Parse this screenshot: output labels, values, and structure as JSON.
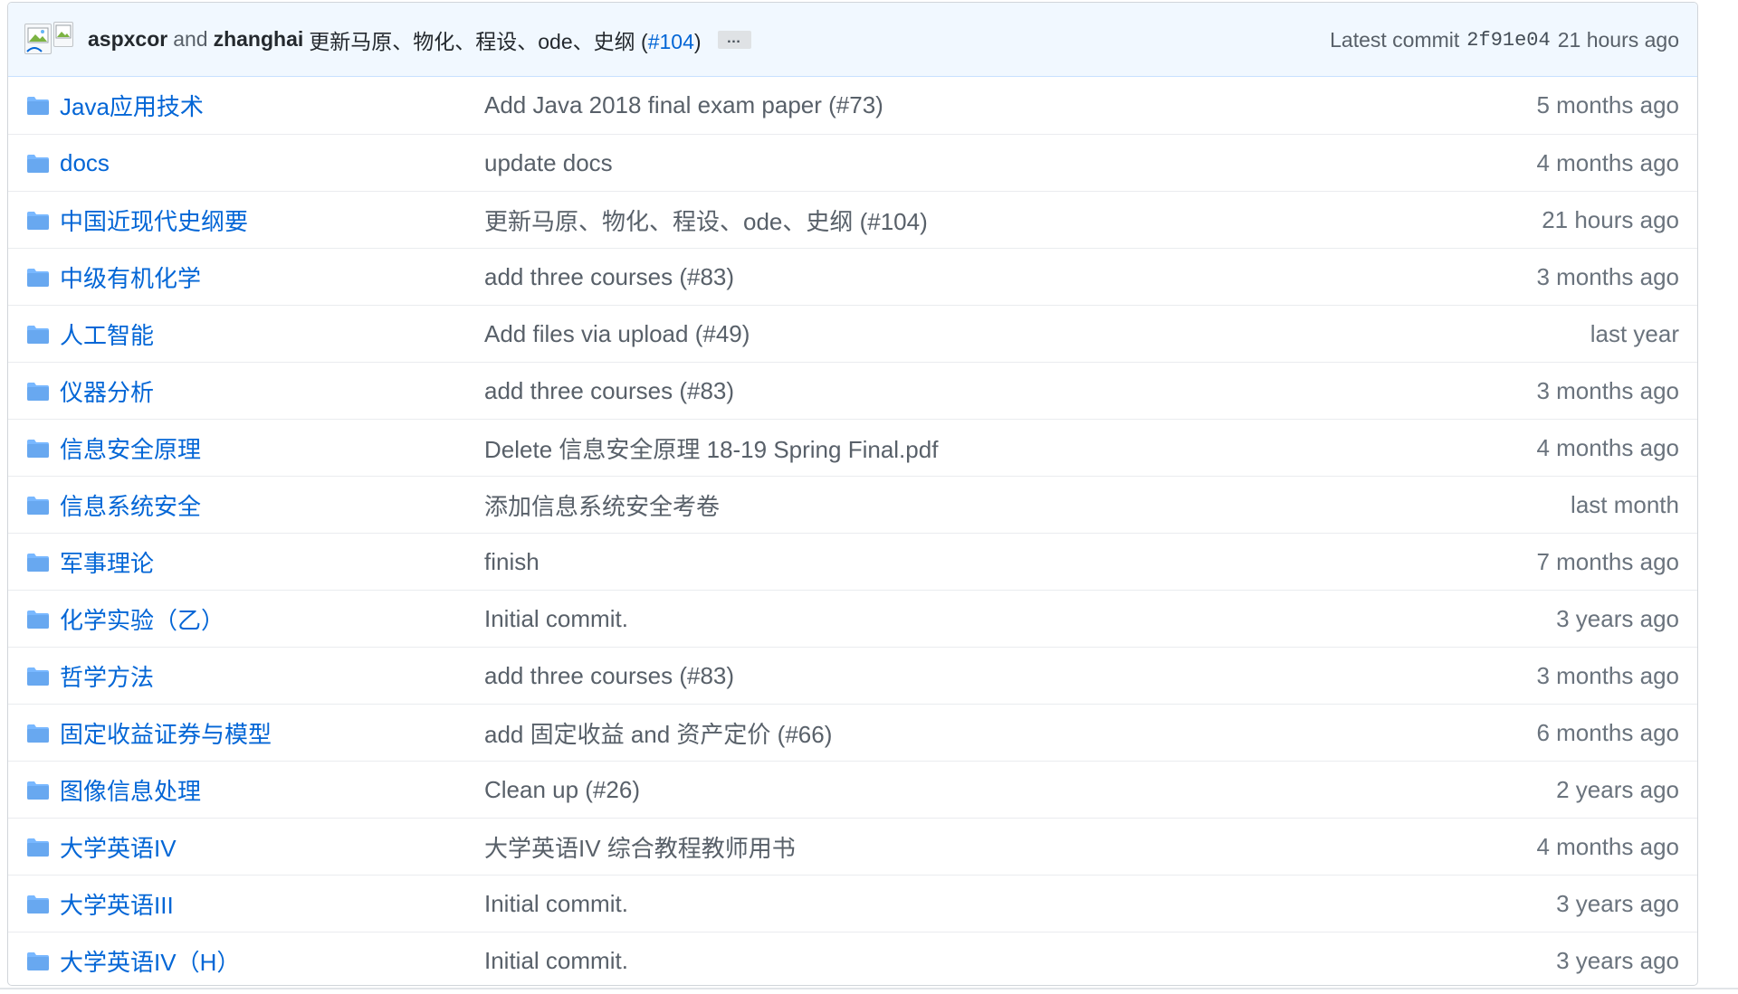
{
  "commit": {
    "author1": "aspxcor",
    "and_text": "and",
    "author2": "zhanghai",
    "message": "更新马原、物化、程设、ode、史纲",
    "pr_open": "(",
    "pr": "#104",
    "pr_close": ")",
    "ellipsis": "…",
    "latest_label": "Latest commit",
    "sha": "2f91e04",
    "age": "21 hours ago"
  },
  "icons": {
    "folder": "folder-icon",
    "avatar": "broken-image-icon"
  },
  "colors": {
    "link": "#0366d6",
    "folder": "#79b8ff",
    "commit_bar_bg": "#f1f8ff"
  },
  "rows": [
    {
      "name": "Java应用技术",
      "message": "Add Java 2018 final exam paper (#73)",
      "age": "5 months ago"
    },
    {
      "name": "docs",
      "message": "update docs",
      "age": "4 months ago"
    },
    {
      "name": "中国近现代史纲要",
      "message": "更新马原、物化、程设、ode、史纲 (#104)",
      "age": "21 hours ago"
    },
    {
      "name": "中级有机化学",
      "message": "add three courses (#83)",
      "age": "3 months ago"
    },
    {
      "name": "人工智能",
      "message": "Add files via upload (#49)",
      "age": "last year"
    },
    {
      "name": "仪器分析",
      "message": "add three courses (#83)",
      "age": "3 months ago"
    },
    {
      "name": "信息安全原理",
      "message": "Delete 信息安全原理 18-19 Spring Final.pdf",
      "age": "4 months ago"
    },
    {
      "name": "信息系统安全",
      "message": "添加信息系统安全考卷",
      "age": "last month"
    },
    {
      "name": "军事理论",
      "message": "finish",
      "age": "7 months ago"
    },
    {
      "name": "化学实验（乙）",
      "message": "Initial commit.",
      "age": "3 years ago"
    },
    {
      "name": "哲学方法",
      "message": "add three courses (#83)",
      "age": "3 months ago"
    },
    {
      "name": "固定收益证券与模型",
      "message": "add 固定收益 and 资产定价 (#66)",
      "age": "6 months ago"
    },
    {
      "name": "图像信息处理",
      "message": "Clean up (#26)",
      "age": "2 years ago"
    },
    {
      "name": "大学英语IV",
      "message": "大学英语IV 综合教程教师用书",
      "age": "4 months ago"
    },
    {
      "name": "大学英语III",
      "message": "Initial commit.",
      "age": "3 years ago"
    },
    {
      "name": "大学英语IV（H）",
      "message": "Initial commit.",
      "age": "3 years ago"
    }
  ]
}
